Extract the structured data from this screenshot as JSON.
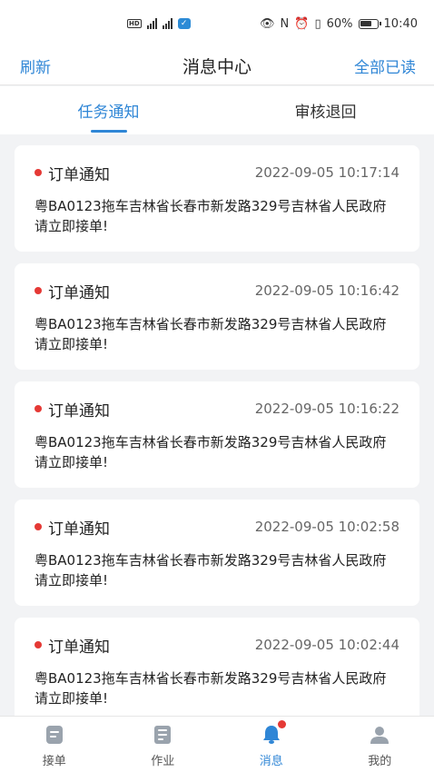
{
  "status_bar": {
    "battery": "60%",
    "time": "10:40"
  },
  "nav": {
    "left": "刷新",
    "title": "消息中心",
    "right": "全部已读"
  },
  "tabs": [
    {
      "label": "任务通知",
      "active": true
    },
    {
      "label": "审核退回",
      "active": false
    }
  ],
  "notifications": [
    {
      "title": "订单通知",
      "time": "2022-09-05 10:17:14",
      "body": "粤BA0123拖车吉林省长春市新发路329号吉林省人民政府 请立即接单!"
    },
    {
      "title": "订单通知",
      "time": "2022-09-05 10:16:42",
      "body": "粤BA0123拖车吉林省长春市新发路329号吉林省人民政府 请立即接单!"
    },
    {
      "title": "订单通知",
      "time": "2022-09-05 10:16:22",
      "body": "粤BA0123拖车吉林省长春市新发路329号吉林省人民政府 请立即接单!"
    },
    {
      "title": "订单通知",
      "time": "2022-09-05 10:02:58",
      "body": "粤BA0123拖车吉林省长春市新发路329号吉林省人民政府 请立即接单!"
    },
    {
      "title": "订单通知",
      "time": "2022-09-05 10:02:44",
      "body": "粤BA0123拖车吉林省长春市新发路329号吉林省人民政府 请立即接单!"
    }
  ],
  "tabbar": [
    {
      "label": "接单",
      "icon": "order-icon",
      "active": false
    },
    {
      "label": "作业",
      "icon": "work-icon",
      "active": false
    },
    {
      "label": "消息",
      "icon": "bell-icon",
      "active": true
    },
    {
      "label": "我的",
      "icon": "user-icon",
      "active": false
    }
  ],
  "colors": {
    "accent": "#2f86d6",
    "unread_dot": "#e53935",
    "icon_inactive": "#9aa3ad"
  }
}
